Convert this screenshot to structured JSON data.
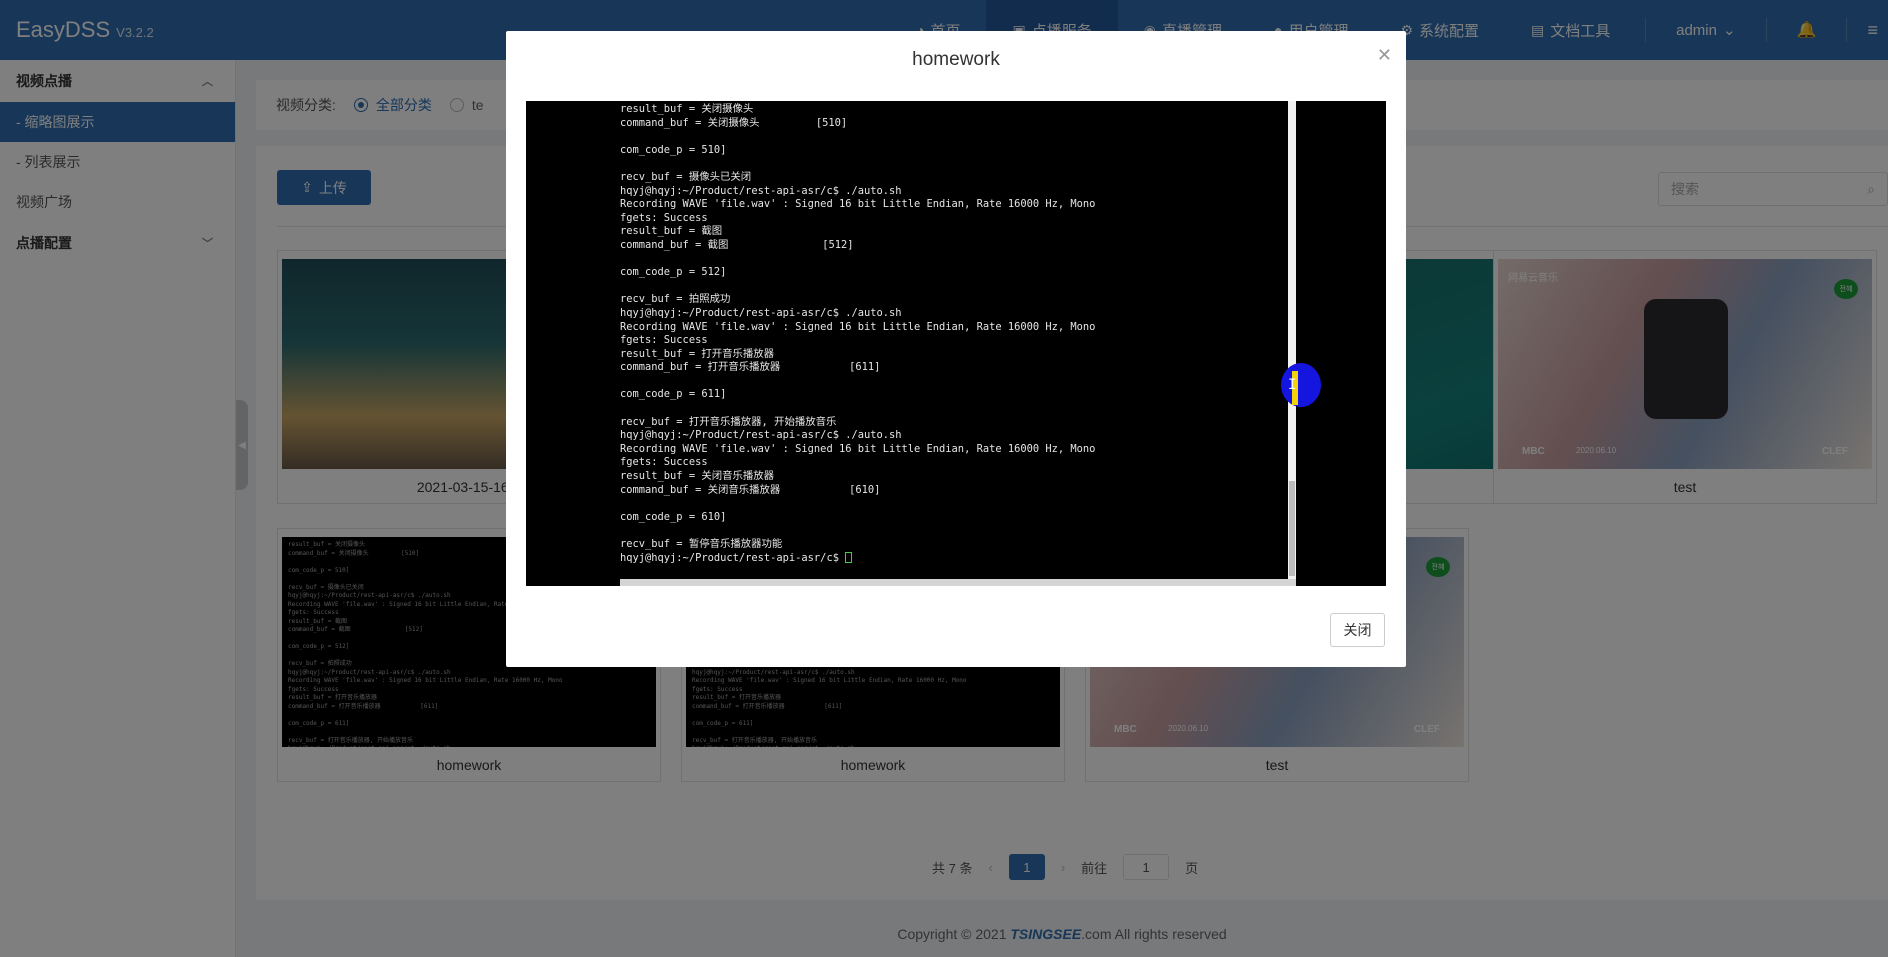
{
  "app": {
    "name": "EasyDSS",
    "version": "V3.2.2"
  },
  "nav": {
    "items": [
      {
        "label": "首页",
        "icon": "dashboard-icon"
      },
      {
        "label": "点播服务",
        "icon": "video-icon"
      },
      {
        "label": "直播管理",
        "icon": "live-icon"
      },
      {
        "label": "用户管理",
        "icon": "user-icon"
      },
      {
        "label": "系统配置",
        "icon": "gear-icon"
      },
      {
        "label": "文档工具",
        "icon": "doc-icon"
      }
    ],
    "user": "admin"
  },
  "sidebar": {
    "group_vod": "视频点播",
    "items": [
      {
        "label": "- 缩略图展示"
      },
      {
        "label": "- 列表展示"
      },
      {
        "label": "视频广场"
      }
    ],
    "group_config": "点播配置"
  },
  "filter": {
    "label": "视频分类:",
    "all": "全部分类",
    "other": "te"
  },
  "toolbar": {
    "upload_label": "上传",
    "search_placeholder": "搜索"
  },
  "videos": [
    {
      "name": "2021-03-15-16-5"
    },
    {
      "name": "test"
    },
    {
      "name": "homework"
    },
    {
      "name": "homework"
    },
    {
      "name": "test"
    }
  ],
  "thumb_texts": {
    "music_badge": "网易云音乐",
    "mbc": "MBC",
    "date": "2020.06.10",
    "clef": "CLEF",
    "tag": "전혜"
  },
  "pagination": {
    "total": "共 7 条",
    "current": "1",
    "goto": "前往",
    "goto_value": "1",
    "page_unit": "页"
  },
  "footer": {
    "prefix": "Copyright © 2021 ",
    "logo": "TSINGSEE",
    "suffix": ".com All rights reserved"
  },
  "modal": {
    "title": "homework",
    "close_button": "关闭",
    "terminal_lines": [
      "result_buf = 关闭摄像头",
      "command_buf = 关闭摄像头         [510]",
      "",
      "com_code_p = 510]",
      "",
      "recv_buf = 摄像头已关闭",
      "hqyj@hqyj:~/Product/rest-api-asr/c$ ./auto.sh",
      "Recording WAVE 'file.wav' : Signed 16 bit Little Endian, Rate 16000 Hz, Mono",
      "fgets: Success",
      "result_buf = 截图",
      "command_buf = 截图               [512]",
      "",
      "com_code_p = 512]",
      "",
      "recv_buf = 拍照成功",
      "hqyj@hqyj:~/Product/rest-api-asr/c$ ./auto.sh",
      "Recording WAVE 'file.wav' : Signed 16 bit Little Endian, Rate 16000 Hz, Mono",
      "fgets: Success",
      "result_buf = 打开音乐播放器",
      "command_buf = 打开音乐播放器           [611]",
      "",
      "com_code_p = 611]",
      "",
      "recv_buf = 打开音乐播放器, 开始播放音乐",
      "hqyj@hqyj:~/Product/rest-api-asr/c$ ./auto.sh",
      "Recording WAVE 'file.wav' : Signed 16 bit Little Endian, Rate 16000 Hz, Mono",
      "fgets: Success",
      "result_buf = 关闭音乐播放器",
      "command_buf = 关闭音乐播放器           [610]",
      "",
      "com_code_p = 610]",
      "",
      "recv_buf = 暂停音乐播放器功能",
      "hqyj@hqyj:~/Product/rest-api-asr/c$ "
    ]
  }
}
